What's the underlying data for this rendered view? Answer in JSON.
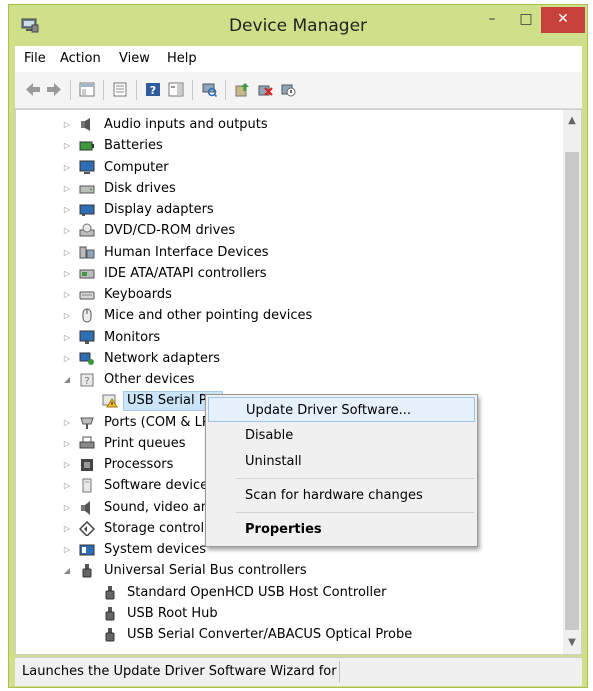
{
  "window": {
    "title": "Device Manager",
    "minimize_glyph": "–",
    "maximize_glyph": "□",
    "close_glyph": "✕",
    "app_icon": "device-manager-icon"
  },
  "menu": {
    "file": "File",
    "action": "Action",
    "view": "View",
    "help": "Help"
  },
  "toolbar_icons": [
    "back-icon",
    "forward-icon",
    "show-hide-console-tree-icon",
    "properties-icon",
    "help-icon",
    "action-pane-icon",
    "scan-hardware-icon",
    "update-driver-icon",
    "uninstall-icon",
    "disable-icon"
  ],
  "tree": [
    {
      "label": "Audio inputs and outputs",
      "icon": "speaker-icon",
      "state": "collapsed"
    },
    {
      "label": "Batteries",
      "icon": "battery-icon",
      "state": "collapsed"
    },
    {
      "label": "Computer",
      "icon": "computer-icon",
      "state": "collapsed"
    },
    {
      "label": "Disk drives",
      "icon": "disk-drive-icon",
      "state": "collapsed"
    },
    {
      "label": "Display adapters",
      "icon": "display-adapter-icon",
      "state": "collapsed"
    },
    {
      "label": "DVD/CD-ROM drives",
      "icon": "dvd-drive-icon",
      "state": "collapsed"
    },
    {
      "label": "Human Interface Devices",
      "icon": "hid-icon",
      "state": "collapsed"
    },
    {
      "label": "IDE ATA/ATAPI controllers",
      "icon": "ide-controller-icon",
      "state": "collapsed"
    },
    {
      "label": "Keyboards",
      "icon": "keyboard-icon",
      "state": "collapsed"
    },
    {
      "label": "Mice and other pointing devices",
      "icon": "mouse-icon",
      "state": "collapsed"
    },
    {
      "label": "Monitors",
      "icon": "monitor-icon",
      "state": "collapsed"
    },
    {
      "label": "Network adapters",
      "icon": "network-adapter-icon",
      "state": "collapsed"
    },
    {
      "label": "Other devices",
      "icon": "unknown-device-icon",
      "state": "expanded"
    },
    {
      "label": "USB Serial Por",
      "icon": "warning-device-icon",
      "state": "child",
      "selected": true
    },
    {
      "label": "Ports (COM & LP",
      "icon": "port-icon",
      "state": "collapsed"
    },
    {
      "label": "Print queues",
      "icon": "printer-icon",
      "state": "collapsed"
    },
    {
      "label": "Processors",
      "icon": "processor-icon",
      "state": "collapsed"
    },
    {
      "label": "Software devices",
      "icon": "software-device-icon",
      "state": "collapsed"
    },
    {
      "label": "Sound, video and",
      "icon": "sound-icon",
      "state": "collapsed"
    },
    {
      "label": "Storage controller",
      "icon": "storage-controller-icon",
      "state": "collapsed"
    },
    {
      "label": "System devices",
      "icon": "system-device-icon",
      "state": "collapsed"
    },
    {
      "label": "Universal Serial Bus controllers",
      "icon": "usb-icon",
      "state": "expanded"
    },
    {
      "label": "Standard OpenHCD USB Host Controller",
      "icon": "usb-icon",
      "state": "child"
    },
    {
      "label": "USB Root Hub",
      "icon": "usb-icon",
      "state": "child"
    },
    {
      "label": "USB Serial Converter/ABACUS Optical Probe",
      "icon": "usb-icon",
      "state": "child"
    }
  ],
  "context_menu": {
    "update": "Update Driver Software...",
    "disable": "Disable",
    "uninstall": "Uninstall",
    "scan": "Scan for hardware changes",
    "properties": "Properties"
  },
  "status": {
    "text": "Launches the Update Driver Software Wizard for t"
  },
  "colors": {
    "frame": "#cfe08a",
    "close": "#c7413a",
    "selection": "#cce4f7",
    "highlight": "#e5f0fb"
  }
}
